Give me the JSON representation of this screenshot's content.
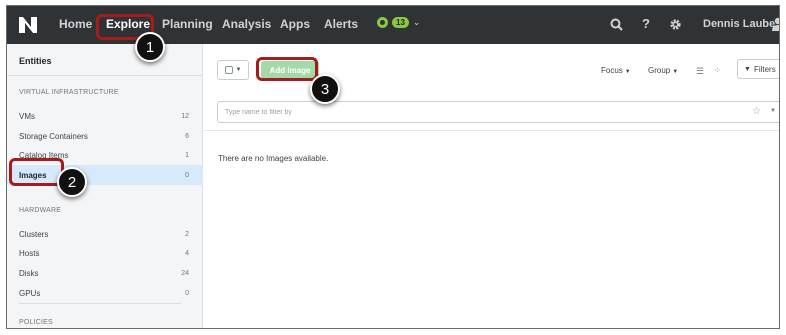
{
  "topbar": {
    "logo_icon": "nutanix-logo-icon",
    "nav": [
      {
        "label": "Home",
        "active": false
      },
      {
        "label": "Explore",
        "active": true
      },
      {
        "label": "Planning",
        "active": false
      },
      {
        "label": "Analysis",
        "active": false
      },
      {
        "label": "Apps",
        "active": false
      },
      {
        "label": "Alerts",
        "active": false
      }
    ],
    "alerts_count": "13",
    "alert_color": "#8dc63f",
    "user_name": "Dennis Laube",
    "icons": [
      "search-icon",
      "help-icon",
      "gear-icon",
      "user-icon"
    ]
  },
  "sidebar": {
    "title": "Entities",
    "sections": [
      {
        "heading": "VIRTUAL INFRASTRUCTURE",
        "items": [
          {
            "label": "VMs",
            "count": "12"
          },
          {
            "label": "Storage Containers",
            "count": "6"
          },
          {
            "label": "Catalog Items",
            "count": "1"
          },
          {
            "label": "Images",
            "count": "0",
            "selected": true
          }
        ]
      },
      {
        "heading": "HARDWARE",
        "items": [
          {
            "label": "Clusters",
            "count": "2"
          },
          {
            "label": "Hosts",
            "count": "4"
          },
          {
            "label": "Disks",
            "count": "24"
          },
          {
            "label": "GPUs",
            "count": "0"
          }
        ]
      },
      {
        "heading": "POLICIES",
        "items": []
      }
    ]
  },
  "toolbar": {
    "add_label": "Add Image",
    "focus_label": "Focus",
    "group_label": "Group",
    "filters_label": "Filters",
    "add_color": "#a5d9a7"
  },
  "search": {
    "placeholder": "Type name to filter by",
    "value": ""
  },
  "main": {
    "empty_message": "There are no Images available."
  },
  "annotations": {
    "callouts": [
      "1",
      "2",
      "3"
    ],
    "highlight_color": "#a51c1c"
  }
}
